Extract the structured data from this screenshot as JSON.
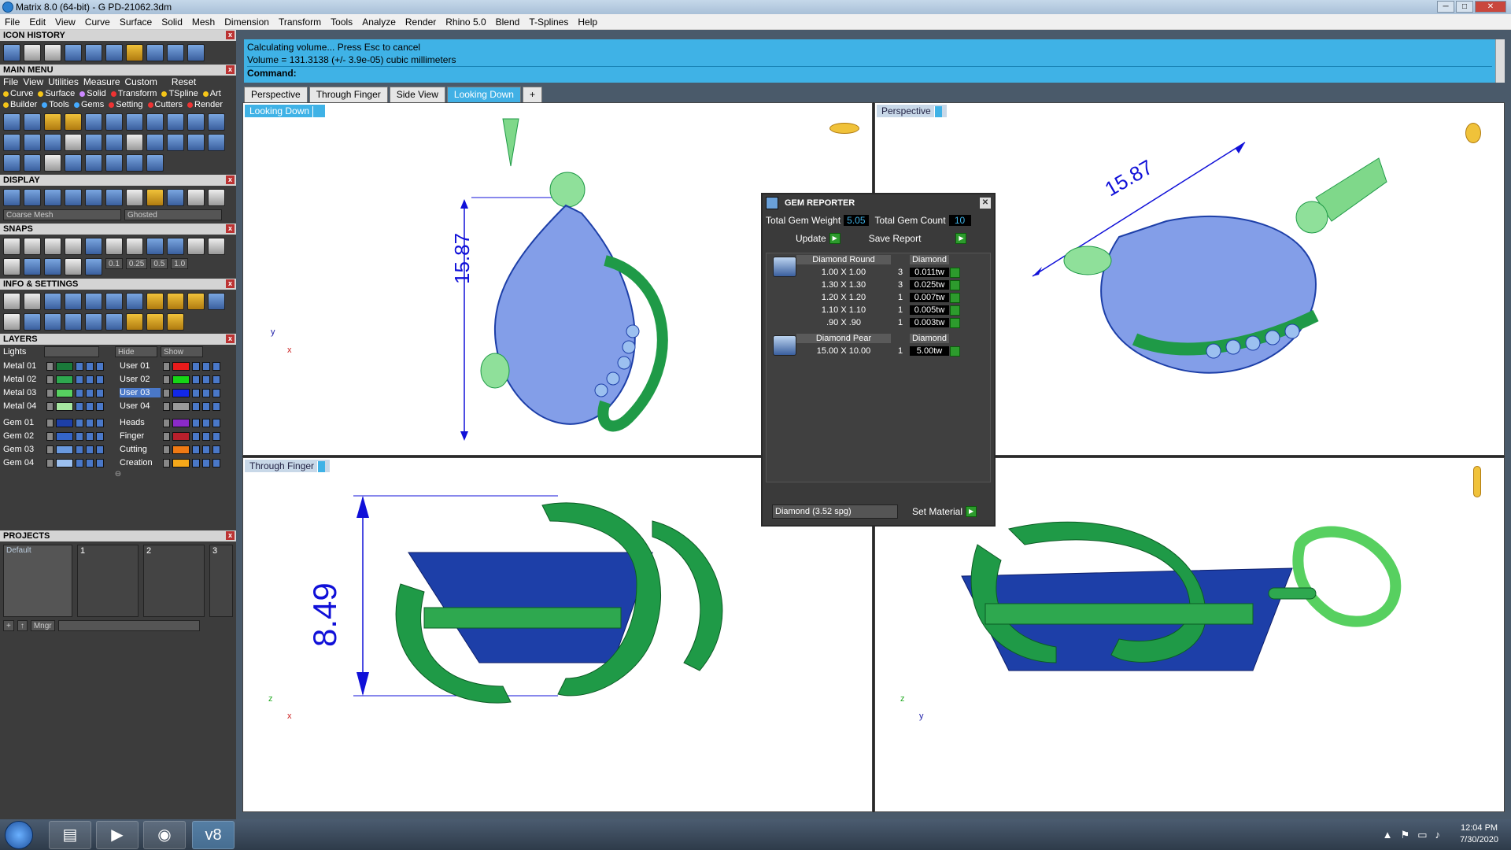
{
  "window": {
    "title": "Matrix 8.0 (64-bit) - G PD-21062.3dm",
    "min": "─",
    "max": "□",
    "close": "✕"
  },
  "menubar": [
    "File",
    "Edit",
    "View",
    "Curve",
    "Surface",
    "Solid",
    "Mesh",
    "Dimension",
    "Transform",
    "Tools",
    "Analyze",
    "Render",
    "Rhino 5.0",
    "Blend",
    "T-Splines",
    "Help"
  ],
  "left": {
    "icon_history": "ICON HISTORY",
    "main_menu": "MAIN MENU",
    "main_menu_row1": [
      "File",
      "View",
      "Utilities",
      "Measure",
      "Custom",
      "Reset"
    ],
    "main_menu_row2": [
      "Curve",
      "Surface",
      "Solid",
      "Transform",
      "TSpline",
      "Art"
    ],
    "main_menu_row3": [
      "Builder",
      "Tools",
      "Gems",
      "Setting",
      "Cutters",
      "Render"
    ],
    "display": "DISPLAY",
    "display_mesh": "Coarse Mesh",
    "display_mode": "Ghosted",
    "snaps": "SNAPS",
    "snap_values": [
      "0.1",
      "0.25",
      "0.5",
      "1.0"
    ],
    "info_settings": "INFO & SETTINGS",
    "layers": "LAYERS",
    "lights_label": "Lights",
    "hide_label": "Hide",
    "show_label": "Show",
    "layers_left": [
      {
        "name": "Metal 01",
        "color": "#1a7a3a"
      },
      {
        "name": "Metal 02",
        "color": "#2ea84f"
      },
      {
        "name": "Metal 03",
        "color": "#57d060"
      },
      {
        "name": "Metal 04",
        "color": "#a6e6a0"
      },
      {
        "name": "Gem 01",
        "color": "#1d3fa8"
      },
      {
        "name": "Gem 02",
        "color": "#3465c8"
      },
      {
        "name": "Gem 03",
        "color": "#6a9ae0"
      },
      {
        "name": "Gem 04",
        "color": "#9cc0f0"
      }
    ],
    "layers_right": [
      {
        "name": "User 01",
        "color": "#e81b1b"
      },
      {
        "name": "User 02",
        "color": "#16d616"
      },
      {
        "name": "User 03",
        "color": "#1228e8"
      },
      {
        "name": "User 04",
        "color": "#9a9a9a"
      },
      {
        "name": "Heads",
        "color": "#8a2ac8"
      },
      {
        "name": "Finger",
        "color": "#b8202c"
      },
      {
        "name": "Cutting",
        "color": "#f07a14"
      },
      {
        "name": "Creation",
        "color": "#f5a81a"
      }
    ],
    "projects": "PROJECTS",
    "project_default": "Default",
    "project_slots": [
      "1",
      "2",
      "3"
    ],
    "mngr": "Mngr"
  },
  "command": {
    "line1": "Calculating volume... Press Esc to cancel",
    "line2": "Volume = 131.3138 (+/- 3.9e-05) cubic millimeters",
    "prompt": "Command:"
  },
  "tabs": [
    "Perspective",
    "Through Finger",
    "Side View",
    "Looking Down"
  ],
  "tab_add": "+",
  "viewports": {
    "tl": {
      "label": "Looking Down",
      "dim": "15.87",
      "axis_y": "y",
      "axis_x": "x"
    },
    "tr": {
      "label": "Perspective",
      "dim": "15.87"
    },
    "bl": {
      "label": "Through Finger",
      "dim": "8.49",
      "axis_z": "z",
      "axis_x": "x"
    },
    "br": {
      "axis_z": "z",
      "axis_y": "y"
    }
  },
  "gem_reporter": {
    "title": "GEM REPORTER",
    "total_weight_label": "Total Gem Weight",
    "total_weight": "5.05",
    "total_count_label": "Total Gem Count",
    "total_count": "10",
    "update": "Update",
    "save_report": "Save Report",
    "groups": [
      {
        "shape": "Diamond Round",
        "material": "Diamond",
        "rows": [
          {
            "size": "1.00 X 1.00",
            "qty": "3",
            "wt": "0.011tw"
          },
          {
            "size": "1.30 X 1.30",
            "qty": "3",
            "wt": "0.025tw"
          },
          {
            "size": "1.20 X 1.20",
            "qty": "1",
            "wt": "0.007tw"
          },
          {
            "size": "1.10 X 1.10",
            "qty": "1",
            "wt": "0.005tw"
          },
          {
            "size": ".90 X .90",
            "qty": "1",
            "wt": "0.003tw"
          }
        ]
      },
      {
        "shape": "Diamond Pear",
        "material": "Diamond",
        "rows": [
          {
            "size": "15.00 X 10.00",
            "qty": "1",
            "wt": "5.00tw"
          }
        ]
      }
    ],
    "material_select": "Diamond      (3.52 spg)",
    "set_material": "Set Material"
  },
  "taskbar": {
    "time": "12:04 PM",
    "date": "7/30/2020"
  },
  "colors": {
    "accent": "#3fb2e6",
    "metal": "#1f9a47",
    "gem": "#1d3fa8",
    "dimension": "#1010d8"
  }
}
